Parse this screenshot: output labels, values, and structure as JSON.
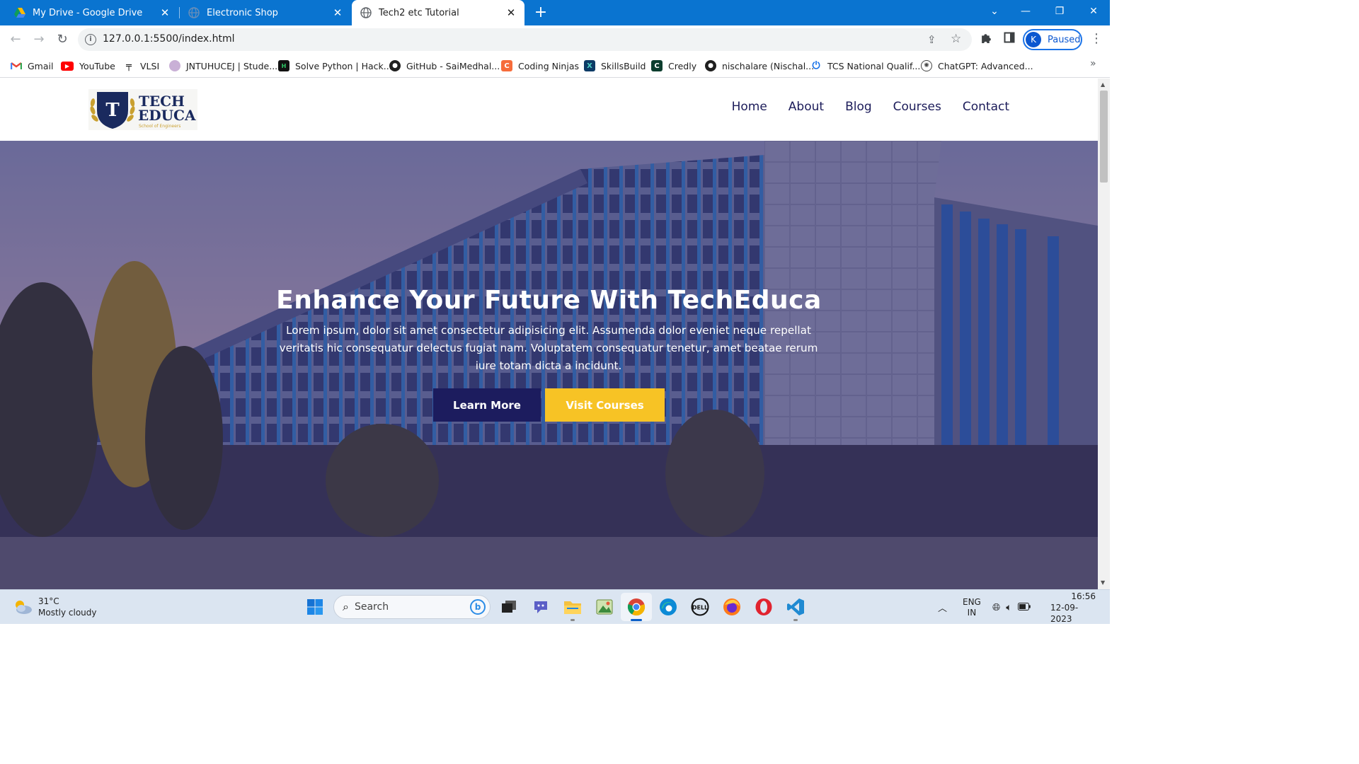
{
  "browser": {
    "tabs": [
      {
        "title": "My Drive - Google Drive",
        "close": "✕"
      },
      {
        "title": "Electronic Shop",
        "close": "✕"
      },
      {
        "title": "Tech2 etc Tutorial",
        "close": "✕"
      }
    ],
    "new_tab": "+",
    "url": "127.0.0.1:5500/index.html",
    "profile_initial": "K",
    "profile_status": "Paused",
    "bookmarks": [
      {
        "label": "Gmail"
      },
      {
        "label": "YouTube"
      },
      {
        "label": "VLSI"
      },
      {
        "label": "JNTUHUCEJ | Stude..."
      },
      {
        "label": "Solve Python | Hack..."
      },
      {
        "label": "GitHub - SaiMedhal..."
      },
      {
        "label": "Coding Ninjas"
      },
      {
        "label": "SkillsBuild"
      },
      {
        "label": "Credly"
      },
      {
        "label": "nischalare (Nischal..."
      },
      {
        "label": "TCS National Qualif..."
      },
      {
        "label": "ChatGPT: Advanced..."
      }
    ]
  },
  "site": {
    "logo": {
      "line1": "TECH",
      "line2": "EDUCA",
      "tagline": "School of Engineers",
      "initial": "T"
    },
    "nav": [
      "Home",
      "About",
      "Blog",
      "Courses",
      "Contact"
    ],
    "hero": {
      "title": "Enhance Your Future With TechEduca",
      "text": "Lorem ipsum, dolor sit amet consectetur adipisicing elit. Assumenda dolor eveniet neque repellat veritatis hic consequatur delectus fugiat nam. Voluptatem consequatur tenetur, amet beatae rerum iure totam dicta a incidunt.",
      "learn_more": "Learn More",
      "visit_courses": "Visit Courses"
    },
    "colors": {
      "navy": "#1c1c5e",
      "yellow": "#f7c325"
    }
  },
  "taskbar": {
    "weather_temp": "31°C",
    "weather_desc": "Mostly cloudy",
    "search_label": "Search",
    "lang_line1": "ENG",
    "lang_line2": "IN",
    "time": "16:56",
    "date": "12-09-2023"
  }
}
